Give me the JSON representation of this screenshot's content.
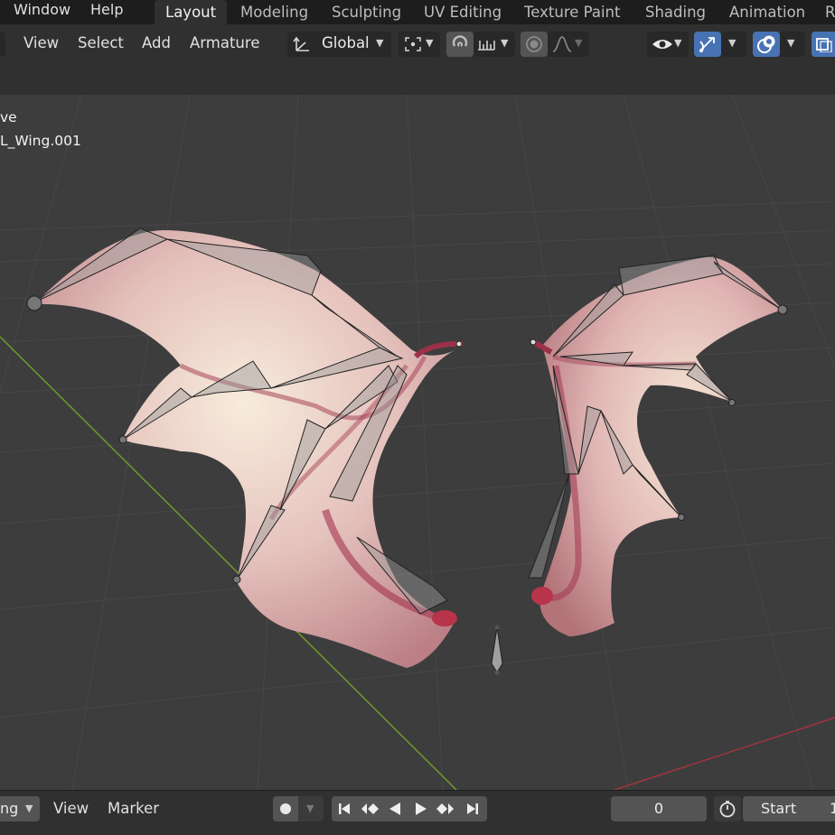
{
  "top_menu": {
    "window": "Window",
    "help": "Help"
  },
  "workspace_tabs": [
    "Layout",
    "Modeling",
    "Sculpting",
    "UV Editing",
    "Texture Paint",
    "Shading",
    "Animation"
  ],
  "header": {
    "view": "View",
    "select": "Select",
    "add": "Add",
    "armature": "Armature",
    "transform_orientation": "Global"
  },
  "viewport": {
    "mode_line": "ve",
    "object_line": "L_Wing.001"
  },
  "timeline": {
    "playback": "ng",
    "view": "View",
    "marker": "Marker",
    "current_frame": "0",
    "start_label": "Start"
  },
  "colors": {
    "accent_blue": "#4772b3",
    "axis_green": "#6f9a2a",
    "axis_red": "#a3343f"
  },
  "icons": [
    "transform-orientation-icon",
    "pivot-point-icon",
    "snap-magnet-icon",
    "snap-increment-icon",
    "proportional-edit-icon",
    "falloff-icon",
    "visibility-icon",
    "gizmo-icon",
    "overlay-icon",
    "xray-icon",
    "record-icon",
    "jump-start-icon",
    "prev-keyframe-icon",
    "play-reverse-icon",
    "play-icon",
    "next-keyframe-icon",
    "jump-end-icon",
    "stopwatch-icon"
  ]
}
